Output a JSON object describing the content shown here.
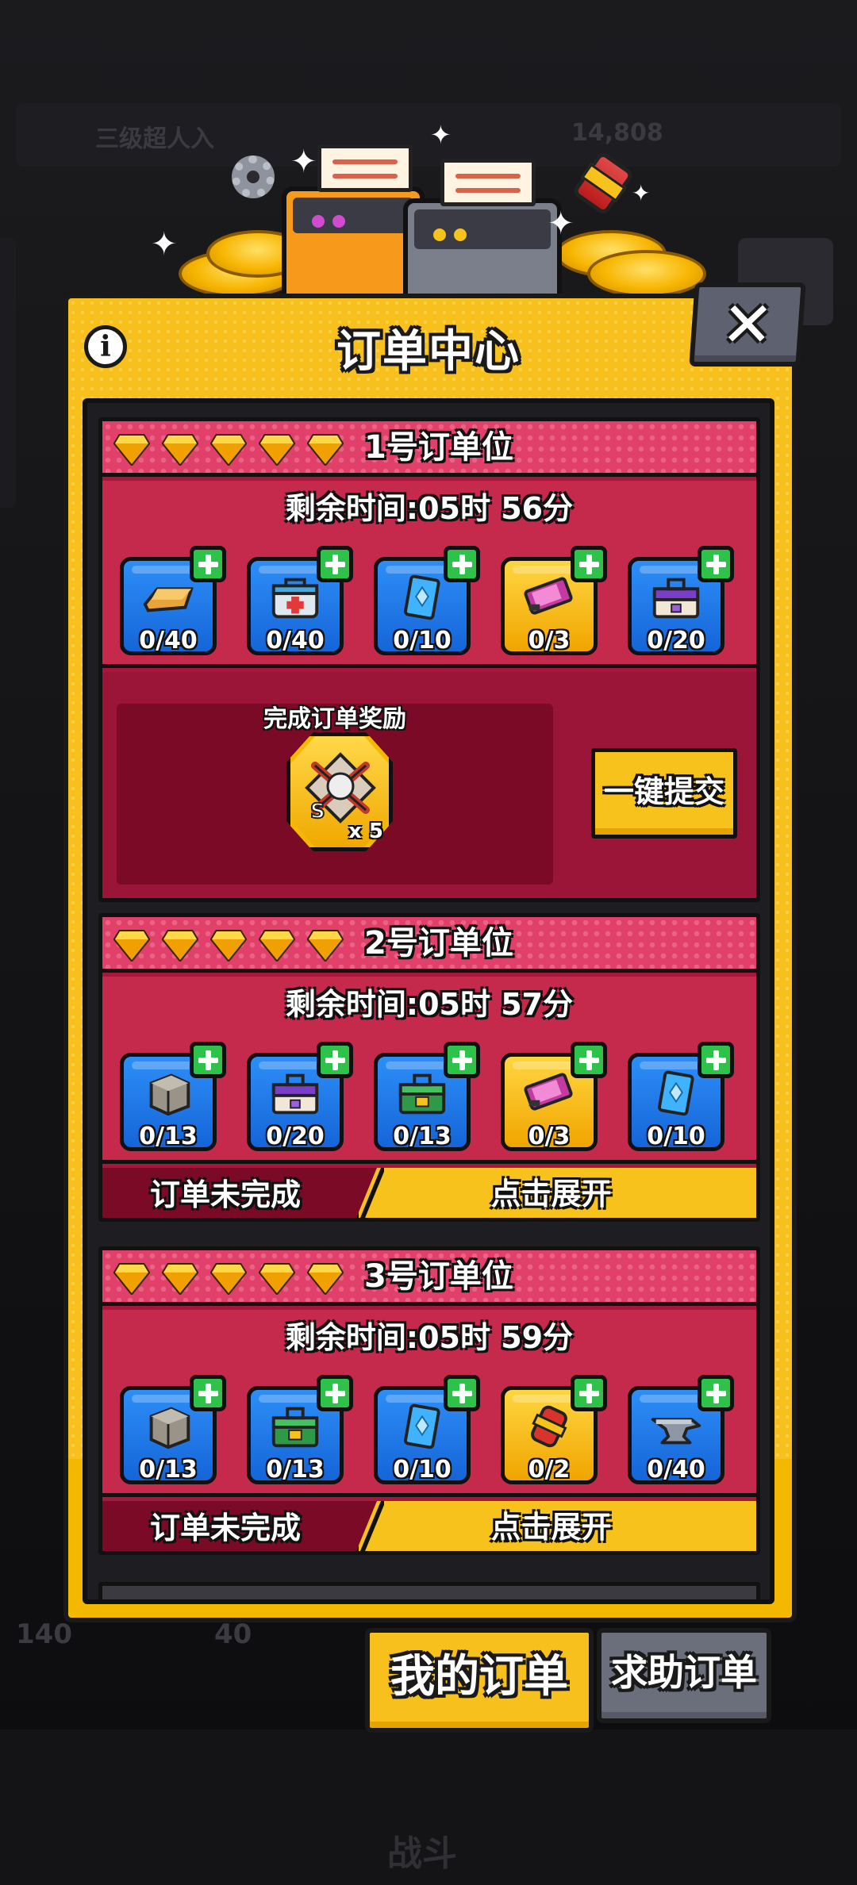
{
  "background": {
    "topbar_left_text": "三级超人入",
    "topbar_right_text": "14,808",
    "bottom_left_count": "140",
    "bottom_mid_count": "40",
    "nav_label": "战斗"
  },
  "panel": {
    "title": "订单中心",
    "info_label": "i",
    "close_label": "✕"
  },
  "orders": [
    {
      "title": "1号订单位",
      "stars": 5,
      "timer": "剩余时间:05时 56分",
      "items": [
        {
          "icon": "gold-bar-icon",
          "count": "0/40",
          "tier": "blue"
        },
        {
          "icon": "medkit-icon",
          "count": "0/40",
          "tier": "blue"
        },
        {
          "icon": "card-icon",
          "count": "0/10",
          "tier": "blue"
        },
        {
          "icon": "battery-icon",
          "count": "0/3",
          "tier": "gold"
        },
        {
          "icon": "purple-toolbox-icon",
          "count": "0/20",
          "tier": "blue"
        }
      ],
      "reward_label": "完成订单奖励",
      "reward_qty": "x 5",
      "reward_icon": "s-grade-fragment-icon",
      "submit_label": "一键提交"
    },
    {
      "title": "2号订单位",
      "stars": 5,
      "timer": "剩余时间:05时 57分",
      "items": [
        {
          "icon": "stone-block-icon",
          "count": "0/13",
          "tier": "blue"
        },
        {
          "icon": "purple-toolbox-icon",
          "count": "0/20",
          "tier": "blue"
        },
        {
          "icon": "green-toolbox-icon",
          "count": "0/13",
          "tier": "blue"
        },
        {
          "icon": "battery-icon",
          "count": "0/3",
          "tier": "gold"
        },
        {
          "icon": "card-icon",
          "count": "0/10",
          "tier": "blue"
        }
      ],
      "status": "订单未完成",
      "expand_label": "点击展开"
    },
    {
      "title": "3号订单位",
      "stars": 5,
      "timer": "剩余时间:05时 59分",
      "items": [
        {
          "icon": "stone-block-icon",
          "count": "0/13",
          "tier": "blue"
        },
        {
          "icon": "green-toolbox-icon",
          "count": "0/13",
          "tier": "blue"
        },
        {
          "icon": "card-icon",
          "count": "0/10",
          "tier": "blue"
        },
        {
          "icon": "red-canister-icon",
          "count": "0/2",
          "tier": "gold"
        },
        {
          "icon": "anvil-icon",
          "count": "0/40",
          "tier": "blue"
        }
      ],
      "status": "订单未完成",
      "expand_label": "点击展开"
    }
  ],
  "tabs": {
    "mine": "我的订单",
    "help": "求助订单"
  },
  "colors": {
    "panel_yellow": "#f7c01d",
    "card_red": "#c52a4c",
    "card_header_pink": "#e0406a",
    "slot_blue": "#1f78eb",
    "slot_gold": "#f5b800",
    "plus_green": "#2fc24a"
  }
}
